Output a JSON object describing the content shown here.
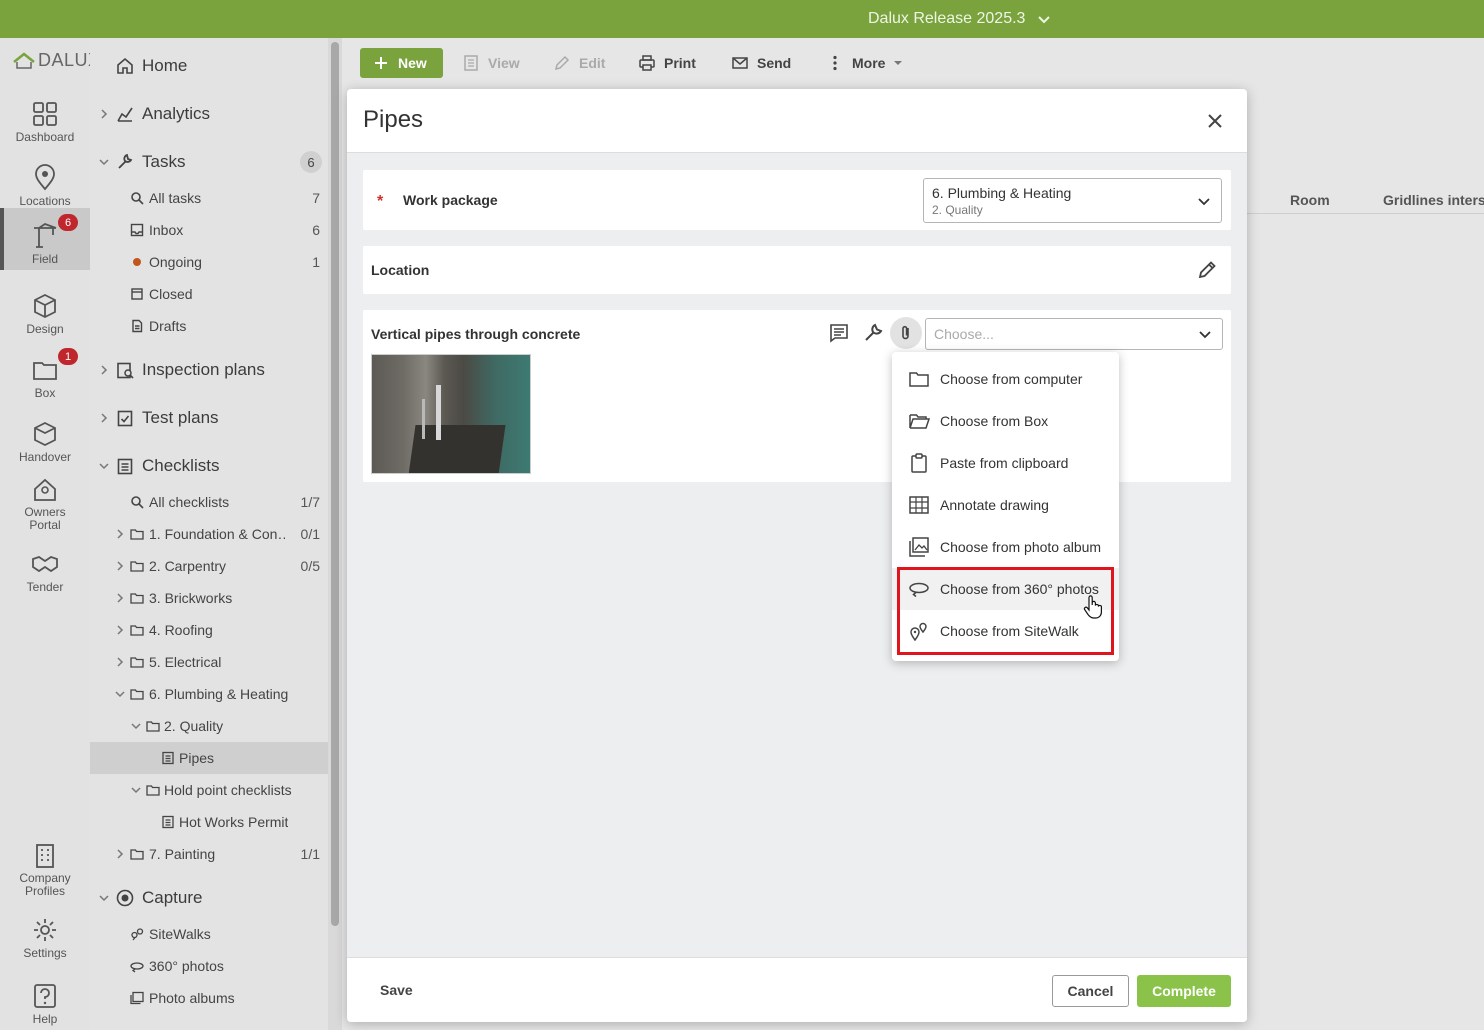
{
  "topbar": {
    "project": "Dalux Release 2025.3"
  },
  "logo": {
    "text": "DALUX"
  },
  "rail": {
    "dashboard": "Dashboard",
    "locations": "Locations",
    "field": "Field",
    "field_badge": "6",
    "design": "Design",
    "box": "Box",
    "box_badge": "1",
    "handover": "Handover",
    "owners_portal": [
      "Owners",
      "Portal"
    ],
    "tender": "Tender",
    "company_profiles": [
      "Company",
      "Profiles"
    ],
    "settings": "Settings",
    "help": "Help"
  },
  "nav": {
    "home": "Home",
    "analytics": "Analytics",
    "tasks": {
      "label": "Tasks",
      "count": "6"
    },
    "all_tasks": {
      "label": "All tasks",
      "count": "7"
    },
    "inbox": {
      "label": "Inbox",
      "count": "6"
    },
    "ongoing": {
      "label": "Ongoing",
      "count": "1"
    },
    "closed": {
      "label": "Closed"
    },
    "drafts": {
      "label": "Drafts"
    },
    "inspection_plans": "Inspection plans",
    "test_plans": "Test plans",
    "checklists": "Checklists",
    "all_checklists": {
      "label": "All checklists",
      "count": "1/7"
    },
    "foundation": {
      "label": "1. Foundation & Con…",
      "count": "0/1"
    },
    "carpentry": {
      "label": "2. Carpentry",
      "count": "0/5"
    },
    "brickworks": {
      "label": "3. Brickworks"
    },
    "roofing": {
      "label": "4. Roofing"
    },
    "electrical": {
      "label": "5. Electrical"
    },
    "plumbing": {
      "label": "6. Plumbing & Heating"
    },
    "quality": {
      "label": "2. Quality"
    },
    "pipes": {
      "label": "Pipes"
    },
    "hold_point": {
      "label": "Hold point checklists"
    },
    "hot_works": {
      "label": "Hot Works Permit"
    },
    "painting": {
      "label": "7. Painting",
      "count": "1/1"
    },
    "capture": "Capture",
    "sitewalks": "SiteWalks",
    "photos360": "360° photos",
    "photo_albums": "Photo albums"
  },
  "toolbar": {
    "new": "New",
    "view": "View",
    "edit": "Edit",
    "print": "Print",
    "send": "Send",
    "more": "More"
  },
  "background_table": {
    "room": "Room",
    "gridlines": "Gridlines interse"
  },
  "modal": {
    "title": "Pipes",
    "work_package": {
      "label": "Work package",
      "value": "6. Plumbing & Heating",
      "sub": "2. Quality"
    },
    "location": {
      "label": "Location"
    },
    "item": {
      "label": "Vertical pipes through concrete",
      "placeholder": "Choose..."
    },
    "save": "Save",
    "cancel": "Cancel",
    "complete": "Complete"
  },
  "attach_menu": {
    "items": [
      {
        "label": "Choose from computer",
        "icon": "folder-icon"
      },
      {
        "label": "Choose from Box",
        "icon": "open-folder-icon"
      },
      {
        "label": "Paste from clipboard",
        "icon": "clipboard-icon"
      },
      {
        "label": "Annotate drawing",
        "icon": "drawing-icon"
      },
      {
        "label": "Choose from photo album",
        "icon": "photo-album-icon"
      },
      {
        "label": "Choose from 360° photos",
        "icon": "360-photo-icon"
      },
      {
        "label": "Choose from SiteWalk",
        "icon": "sitewalk-icon"
      }
    ]
  },
  "colors": {
    "topbar": "#7aa33e",
    "complete_button": "#8bc34a",
    "badge": "#c0272d",
    "highlight": "#e0141c",
    "ongoing_dot": "#c0561b"
  }
}
